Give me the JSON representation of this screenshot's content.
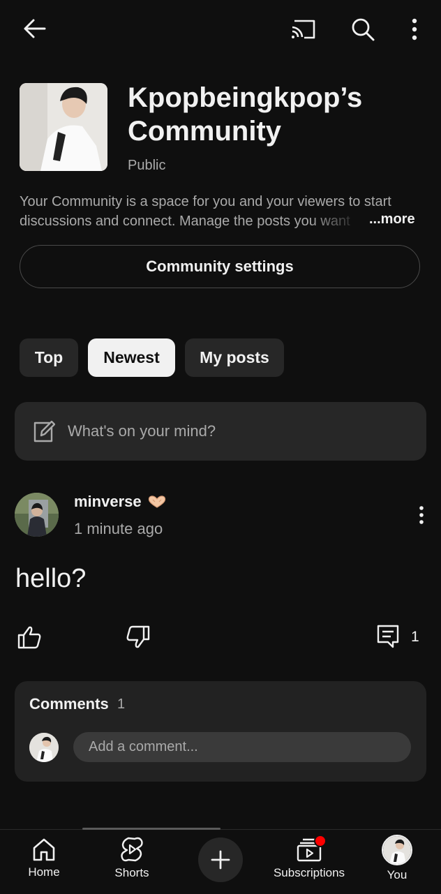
{
  "header": {
    "title": "Kpopbeingkpop’s Community",
    "visibility": "Public",
    "description_line1": "Your Community is a space for you and your viewers to start",
    "description_line2": "discussions and connect. Manage the posts you want",
    "more_label": "...more",
    "settings_label": "Community settings"
  },
  "toolbar": {
    "back_icon": "arrow-left-icon",
    "cast_icon": "cast-icon",
    "search_icon": "search-icon",
    "more_icon": "more-vert-icon"
  },
  "chips": [
    {
      "label": "Top",
      "selected": false
    },
    {
      "label": "Newest",
      "selected": true
    },
    {
      "label": "My posts",
      "selected": false
    }
  ],
  "compose": {
    "placeholder": "What's on your mind?",
    "icon": "edit-icon"
  },
  "post": {
    "author": "minverse",
    "author_emoji": "heart-hands-icon",
    "time": "1 minute ago",
    "body": "hello?",
    "comment_count": "1"
  },
  "comments": {
    "label": "Comments",
    "count": "1",
    "placeholder": "Add a comment..."
  },
  "nav": {
    "items": [
      {
        "label": "Home",
        "icon": "home-icon"
      },
      {
        "label": "Shorts",
        "icon": "shorts-icon"
      },
      {
        "label": "Subscriptions",
        "icon": "subscriptions-icon"
      },
      {
        "label": "You",
        "icon": "avatar"
      }
    ],
    "create_icon": "plus-icon"
  },
  "colors": {
    "background": "#0f0f0f",
    "surface": "#272727",
    "text_primary": "#f1f1f1",
    "text_secondary": "#aaaaaa",
    "notification_dot": "#ff0000"
  }
}
